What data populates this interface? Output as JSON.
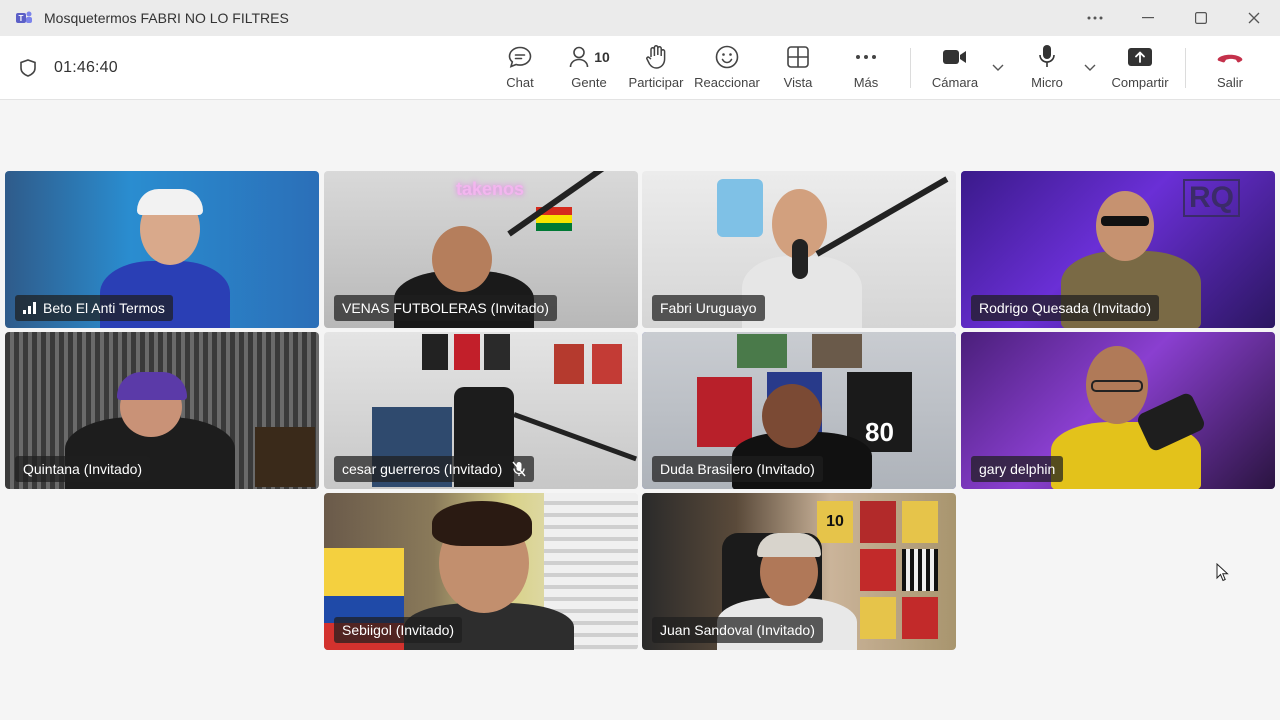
{
  "window": {
    "title": "Mosquetermos FABRI NO LO FILTRES",
    "controls": [
      "more-icon",
      "minimize-icon",
      "maximize-icon",
      "close-icon"
    ]
  },
  "toolbar": {
    "timer": "01:46:40",
    "buttons": {
      "chat": "Chat",
      "people": "Gente",
      "people_count": "10",
      "raise": "Participar",
      "react": "Reaccionar",
      "view": "Vista",
      "more": "Más",
      "camera": "Cámara",
      "mic": "Micro",
      "share": "Compartir",
      "leave": "Salir"
    },
    "colors": {
      "leave": "#c4314b",
      "icon": "#444444"
    }
  },
  "participants": [
    {
      "name": "Beto El Anti Termos",
      "signal": true,
      "speaking": false
    },
    {
      "name": "VENAS FUTBOLERAS (Invitado)",
      "speaking": false,
      "overlay_text": "takenos"
    },
    {
      "name": "Fabri Uruguayo",
      "speaking": false
    },
    {
      "name": "Rodrigo Quesada (Invitado)",
      "speaking": true,
      "overlay_text": "RQ"
    },
    {
      "name": "Quintana (Invitado)",
      "speaking": false
    },
    {
      "name": "cesar guerreros (Invitado)",
      "muted": true,
      "speaking": false
    },
    {
      "name": "Duda Brasilero (Invitado)",
      "speaking": true,
      "overlay_text": "80"
    },
    {
      "name": "gary delphin",
      "speaking": true
    },
    {
      "name": "Sebiigol (Invitado)",
      "speaking": false
    },
    {
      "name": "Juan Sandoval (Invitado)",
      "speaking": false,
      "overlay_text": "10"
    }
  ],
  "accent_color": "#6e72e0"
}
